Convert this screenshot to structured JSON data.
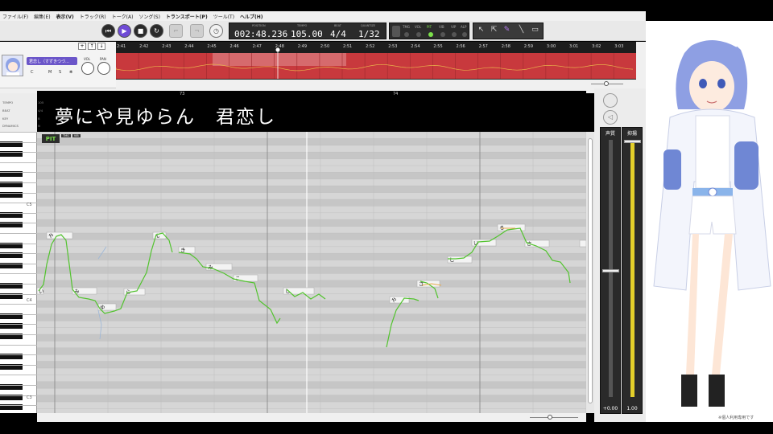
{
  "menu": [
    "ファイル(F)",
    "編集(E)",
    "表示(V)",
    "トラック(R)",
    "トーク(A)",
    "ソング(S)",
    "トランスポート(P)",
    "ツール(T)",
    "ヘルプ(H)"
  ],
  "display": {
    "position_label": "POSITION",
    "position": "002:48.236",
    "tempo_label": "TEMPO",
    "tempo": "105.00",
    "beat_label": "BEAT",
    "beat": "4/4",
    "quantize_label": "QUANTIZE",
    "quantize": "1/32"
  },
  "modes": [
    "TMG",
    "VOL",
    "PIT",
    "VIB",
    "VIP",
    "ALP"
  ],
  "track": {
    "name": "君恋し（すずきつづ…",
    "vol_label": "VOL",
    "pan_label": "PAN",
    "buttons": [
      "C",
      "M",
      "S"
    ]
  },
  "ruler_times": [
    "2:41",
    "2:42",
    "2:43",
    "2:44",
    "2:45",
    "2:46",
    "2:47",
    "2:48",
    "2:49",
    "2:50",
    "2:51",
    "2:52",
    "2:53",
    "2:54",
    "2:55",
    "2:56",
    "2:57",
    "2:58",
    "2:59",
    "3:00",
    "3:01",
    "3:02",
    "3:03"
  ],
  "editor_labels": [
    "TEMPO",
    "BEAT",
    "KEY",
    "DYNAMICS"
  ],
  "editor_values": [
    "105",
    "4/4",
    "B",
    "N"
  ],
  "lyric": "夢にや見ゆらん　君恋し",
  "bar_numbers": [
    "73",
    "74"
  ],
  "octaves": [
    "C5",
    "C4",
    "C3"
  ],
  "pit_badge": "PIT",
  "pit_sub": [
    "TMG",
    "VIB"
  ],
  "notes": [
    "や",
    "み",
    "ゆ",
    "ら",
    "ん",
    "き",
    "み",
    "こ",
    "い",
    "し",
    "や",
    "さ",
    "し",
    "い",
    "ろ",
    "さ"
  ],
  "mixer": {
    "fader1_label": "声質",
    "fader1_value": "+0.00",
    "fader2_label": "抑揚",
    "fader2_value": "1.00",
    "fader2_level": 1.0
  },
  "character_note": "※個人利用専用です",
  "colors": {
    "accent": "#6f4bd6",
    "pitch": "#52c32e",
    "band": "#c8393d"
  }
}
